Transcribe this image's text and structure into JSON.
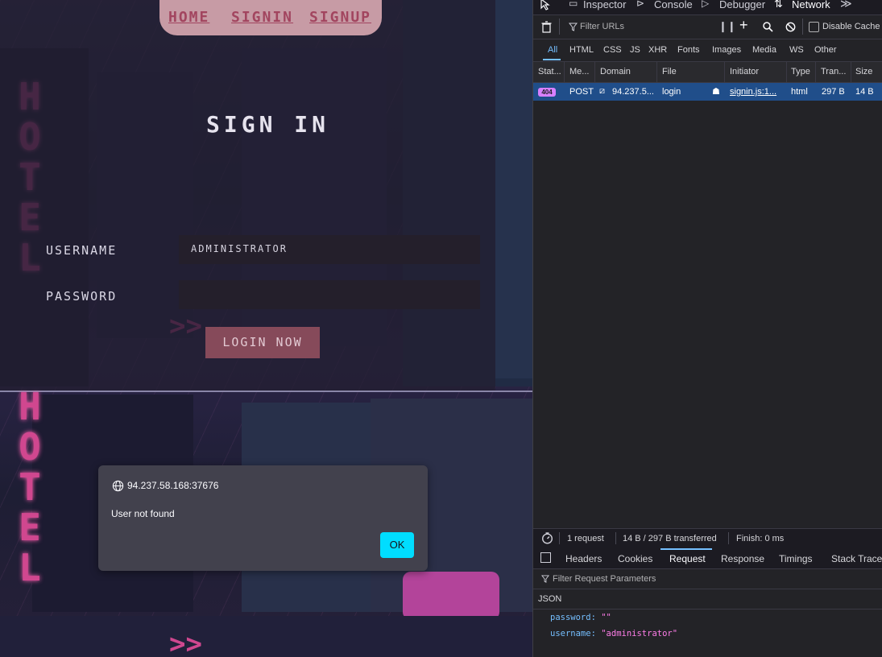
{
  "site": {
    "nav": {
      "home": "HOME",
      "signin": "SIGNIN",
      "signup": "SIGNUP"
    },
    "title": "SIGN IN",
    "username_label": "USERNAME",
    "username_value": "ADMINISTRATOR",
    "password_label": "PASSWORD",
    "password_value": "",
    "login_button": "LOGIN NOW",
    "neon_sign": "HOTEL"
  },
  "alert": {
    "origin": "94.237.58.168:37676",
    "message": "User not found",
    "ok": "OK"
  },
  "devtools": {
    "tabs": {
      "inspector": "Inspector",
      "console": "Console",
      "debugger": "Debugger",
      "network": "Network"
    },
    "filter_placeholder": "Filter URLs",
    "disable_cache": "Disable Cache",
    "filters": [
      "All",
      "HTML",
      "CSS",
      "JS",
      "XHR",
      "Fonts",
      "Images",
      "Media",
      "WS",
      "Other"
    ],
    "columns": [
      "Stat...",
      "Me...",
      "Domain",
      "File",
      "Initiator",
      "Type",
      "Tran...",
      "Size"
    ],
    "request": {
      "status": "404",
      "method": "POST",
      "domain": "94.237.5...",
      "file": "login",
      "initiator": "signin.js:1...",
      "type": "html",
      "transferred": "297 B",
      "size": "14 B"
    },
    "summary": {
      "requests": "1 request",
      "transferred": "14 B / 297 B transferred",
      "finish": "Finish: 0 ms"
    },
    "detail_tabs": [
      "Headers",
      "Cookies",
      "Request",
      "Response",
      "Timings",
      "Stack Trace"
    ],
    "request_filter_placeholder": "Filter Request Parameters",
    "json_label": "JSON",
    "params": [
      {
        "key": "password:",
        "value": "\"\""
      },
      {
        "key": "username:",
        "value": "\"administrator\""
      }
    ]
  },
  "colors": {
    "accent": "#00ddff",
    "selected_row": "#204e8a",
    "badge_404": "#d880ff",
    "neon": "#d0478f"
  }
}
